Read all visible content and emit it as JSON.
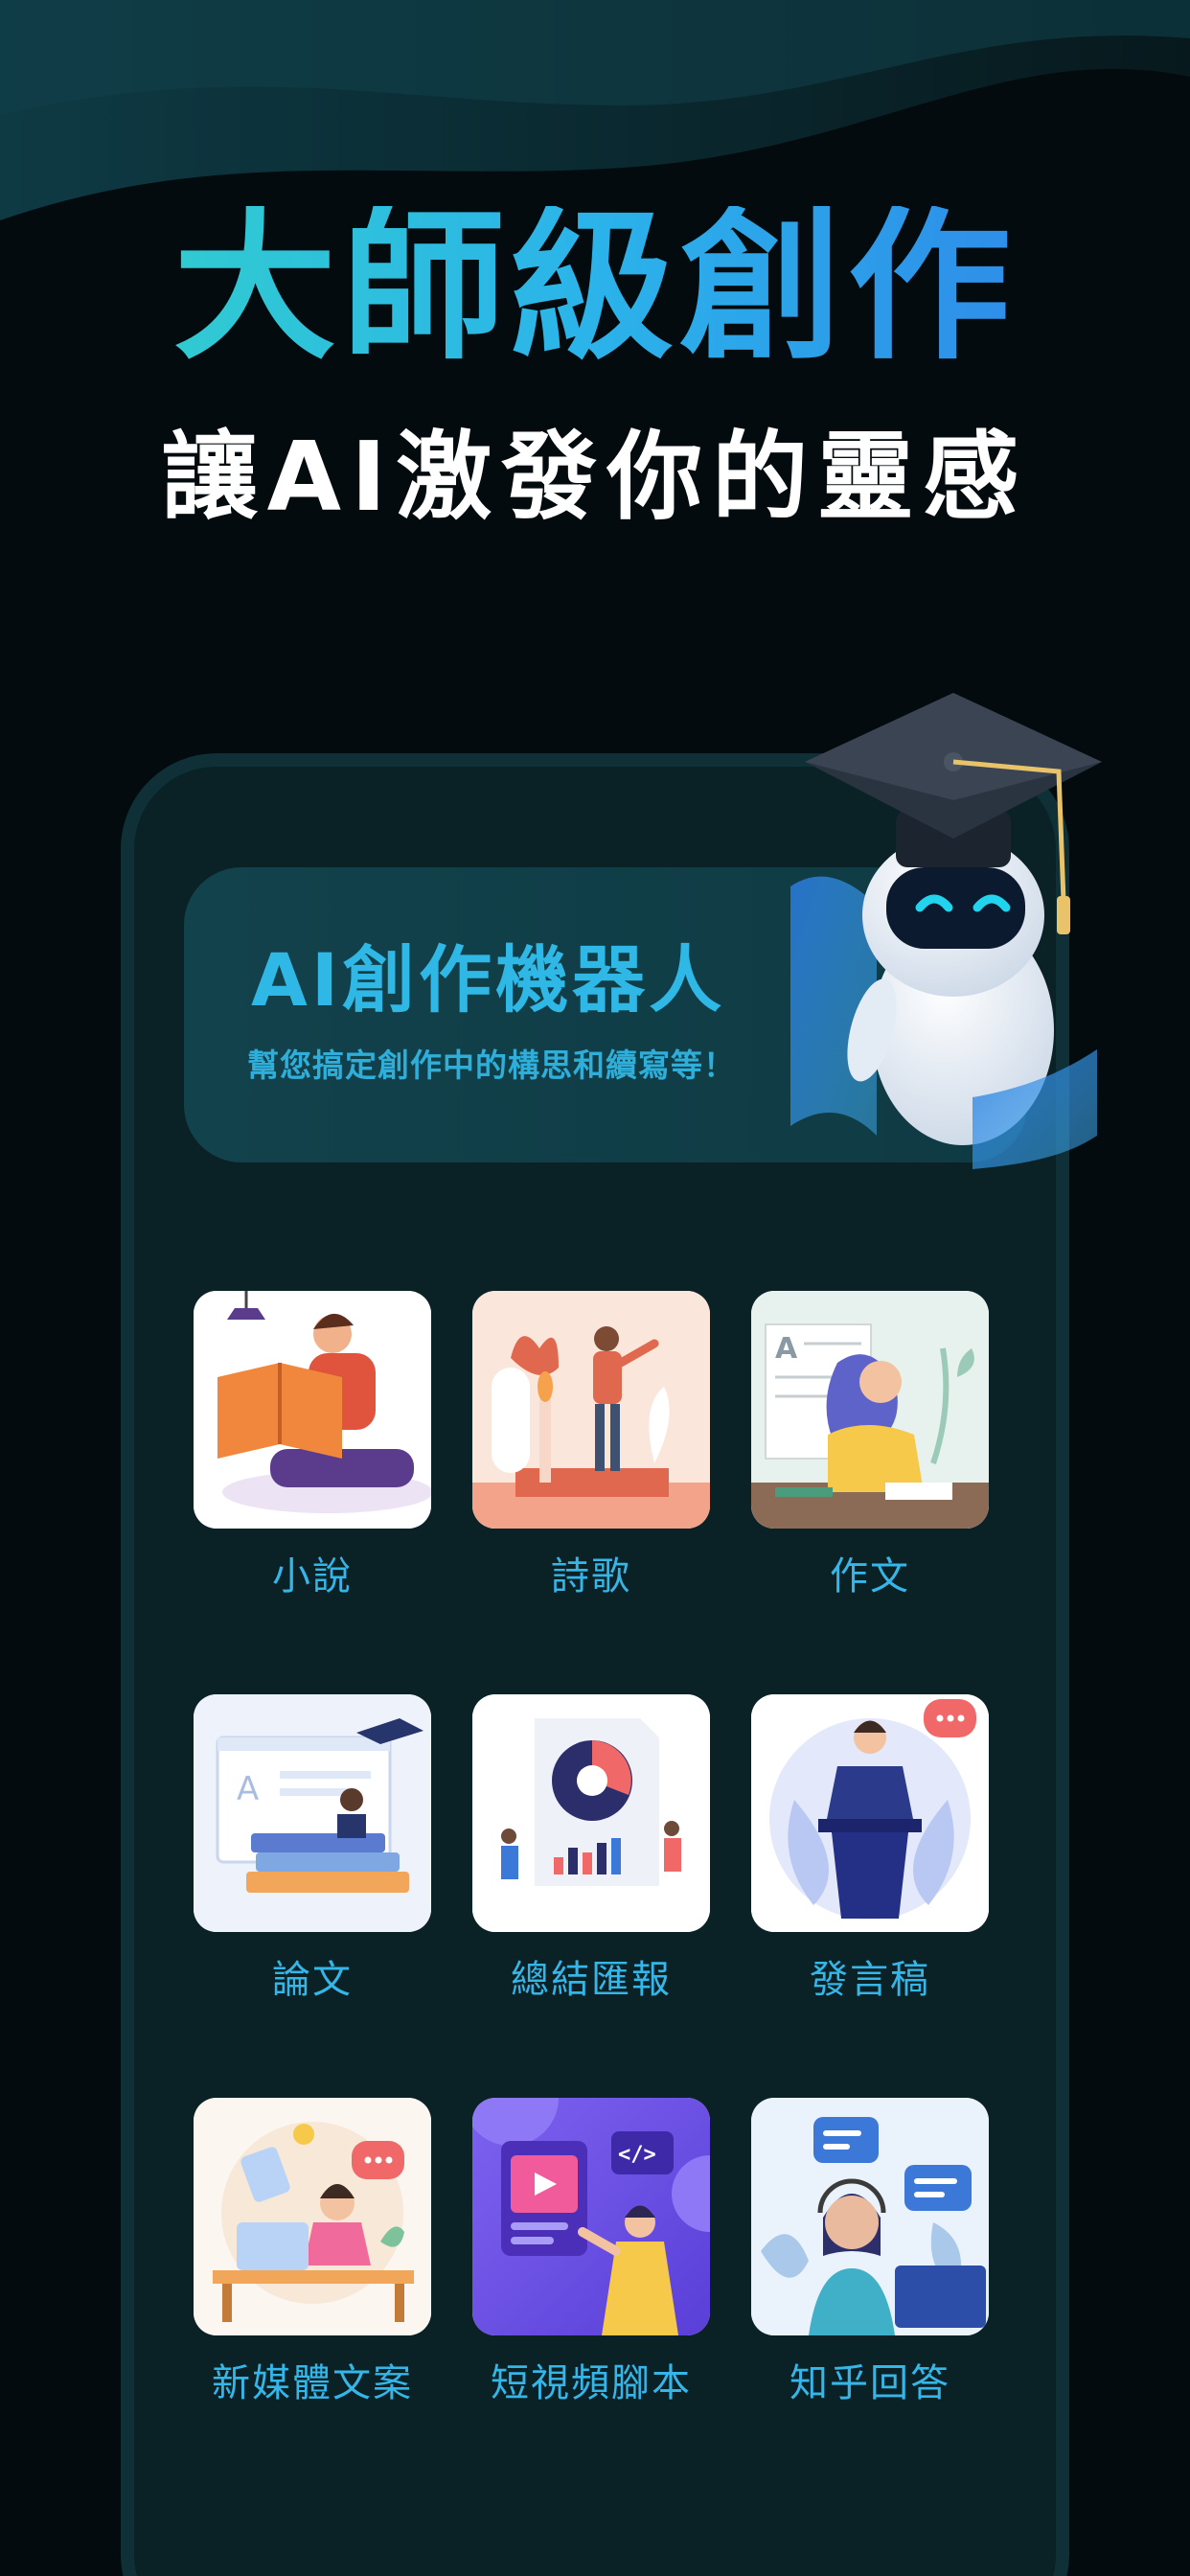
{
  "hero": {
    "title": "大師級創作",
    "subtitle": "讓AI激發你的靈感"
  },
  "banner": {
    "title": "AI創作機器人",
    "subtitle": "幫您搞定創作中的構思和續寫等！"
  },
  "categories": [
    {
      "label": "小說",
      "icon": "reading-person-icon"
    },
    {
      "label": "詩歌",
      "icon": "poet-candle-icon"
    },
    {
      "label": "作文",
      "icon": "writing-girl-icon"
    },
    {
      "label": "論文",
      "icon": "thesis-books-icon"
    },
    {
      "label": "總結匯報",
      "icon": "report-chart-icon"
    },
    {
      "label": "發言稿",
      "icon": "speaker-podium-icon"
    },
    {
      "label": "新媒體文案",
      "icon": "new-media-icon"
    },
    {
      "label": "短視頻腳本",
      "icon": "video-script-icon"
    },
    {
      "label": "知乎回答",
      "icon": "answer-support-icon"
    }
  ],
  "colors": {
    "background": "#030b0e",
    "accent": "#35b6e9",
    "frame": "#0a2126"
  }
}
